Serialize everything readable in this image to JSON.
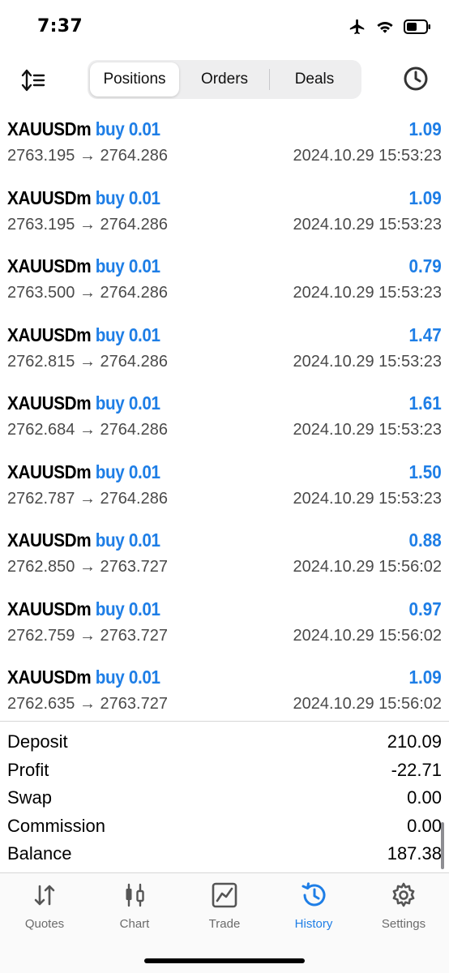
{
  "status": {
    "time": "7:37"
  },
  "toolbar": {
    "segments": [
      {
        "label": "Positions",
        "active": true
      },
      {
        "label": "Orders",
        "active": false
      },
      {
        "label": "Deals",
        "active": false
      }
    ]
  },
  "rows": [
    {
      "symbol": "XAUUSDm",
      "side": "buy 0.01",
      "profit": "1.09",
      "prices": "2763.195 → 2764.286",
      "time": "2024.10.29 15:53:23"
    },
    {
      "symbol": "XAUUSDm",
      "side": "buy 0.01",
      "profit": "1.09",
      "prices": "2763.195 → 2764.286",
      "time": "2024.10.29 15:53:23"
    },
    {
      "symbol": "XAUUSDm",
      "side": "buy 0.01",
      "profit": "0.79",
      "prices": "2763.500 → 2764.286",
      "time": "2024.10.29 15:53:23"
    },
    {
      "symbol": "XAUUSDm",
      "side": "buy 0.01",
      "profit": "1.47",
      "prices": "2762.815 → 2764.286",
      "time": "2024.10.29 15:53:23"
    },
    {
      "symbol": "XAUUSDm",
      "side": "buy 0.01",
      "profit": "1.61",
      "prices": "2762.684 → 2764.286",
      "time": "2024.10.29 15:53:23"
    },
    {
      "symbol": "XAUUSDm",
      "side": "buy 0.01",
      "profit": "1.50",
      "prices": "2762.787 → 2764.286",
      "time": "2024.10.29 15:53:23"
    },
    {
      "symbol": "XAUUSDm",
      "side": "buy 0.01",
      "profit": "0.88",
      "prices": "2762.850 → 2763.727",
      "time": "2024.10.29 15:56:02"
    },
    {
      "symbol": "XAUUSDm",
      "side": "buy 0.01",
      "profit": "0.97",
      "prices": "2762.759 → 2763.727",
      "time": "2024.10.29 15:56:02"
    },
    {
      "symbol": "XAUUSDm",
      "side": "buy 0.01",
      "profit": "1.09",
      "prices": "2762.635 → 2763.727",
      "time": "2024.10.29 15:56:02"
    }
  ],
  "summary": [
    {
      "label": "Deposit",
      "value": "210.09"
    },
    {
      "label": "Profit",
      "value": "-22.71"
    },
    {
      "label": "Swap",
      "value": "0.00"
    },
    {
      "label": "Commission",
      "value": "0.00"
    },
    {
      "label": "Balance",
      "value": "187.38"
    }
  ],
  "tabs": [
    {
      "label": "Quotes",
      "icon": "quotes-arrows-icon",
      "active": false
    },
    {
      "label": "Chart",
      "icon": "candlestick-icon",
      "active": false
    },
    {
      "label": "Trade",
      "icon": "trade-chart-icon",
      "active": false
    },
    {
      "label": "History",
      "icon": "history-icon",
      "active": true
    },
    {
      "label": "Settings",
      "icon": "gear-icon",
      "active": false
    }
  ],
  "colors": {
    "accent": "#1e7ee6",
    "text": "#000000",
    "secondary": "#4a4a4a",
    "inactive_tab": "#6b6b6b"
  }
}
